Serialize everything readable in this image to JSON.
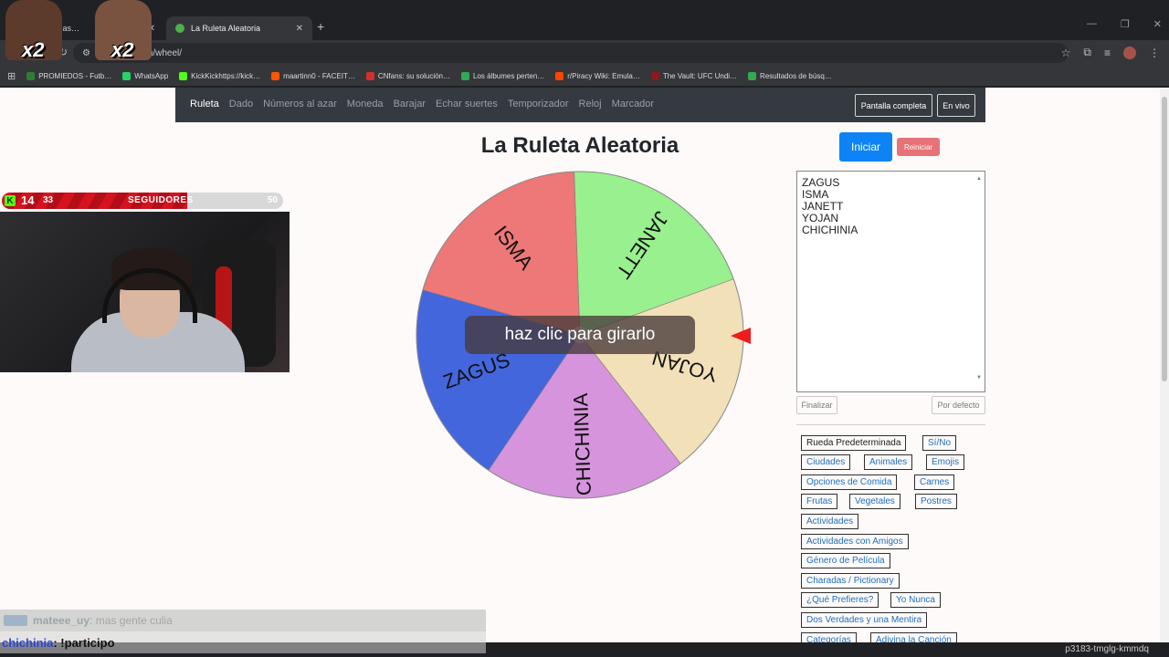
{
  "browser": {
    "tabs": [
      {
        "title": "m - Kick Das…"
      },
      {
        "title": "La Ruleta Aleatoria"
      }
    ],
    "url": ".com/random/wheel/",
    "bookmarks": [
      {
        "label": "PROMIEDOS - Futb…",
        "color": "#2e7d32"
      },
      {
        "label": "WhatsApp",
        "color": "#25d366"
      },
      {
        "label": "KickKickhttps://kick…",
        "color": "#53fc18"
      },
      {
        "label": "maartinn0 - FACEIT…",
        "color": "#ff5500"
      },
      {
        "label": "CNfans: su solución…",
        "color": "#d32f2f"
      },
      {
        "label": "Los álbumes perten…",
        "color": "#34a853"
      },
      {
        "label": "r/Piracy Wiki: Emula…",
        "color": "#ff4500"
      },
      {
        "label": "The Vault: UFC Undi…",
        "color": "#8b1a1a"
      },
      {
        "label": "Resultados de búsq…",
        "color": "#34a853"
      }
    ],
    "status_id": "p3183-tmglg-kmmdq"
  },
  "site": {
    "nav": [
      "Ruleta",
      "Dado",
      "Números al azar",
      "Moneda",
      "Barajar",
      "Echar suertes",
      "Temporizador",
      "Reloj",
      "Marcador"
    ],
    "fullscreen_label": "Pantalla completa",
    "live_label": "En vivo",
    "title": "La Ruleta Aleatoria",
    "start_label": "Iniciar",
    "reset_label": "Reiniciar",
    "names": [
      "ZAGUS",
      "ISMA",
      "JANETT",
      "YOJAN",
      "CHICHINIA"
    ],
    "finish_label": "Finalizar",
    "default_label": "Por defecto",
    "spin_hint": "haz clic para girarlo",
    "presets": [
      "Rueda Predeterminada",
      "Sí/No",
      "Ciudades",
      "Animales",
      "Emojis",
      "Opciones de Comida",
      "Carnes",
      "Frutas",
      "Vegetales",
      "Postres",
      "Actividades",
      "Actividades con Amigos",
      "Género de Película",
      "Charadas / Pictionary",
      "¿Qué Prefieres?",
      "Yo Nunca",
      "Dos Verdades y una Mentira",
      "Categorías",
      "Adivina la Canción"
    ]
  },
  "wheel": {
    "segments": [
      {
        "label": "ZAGUS",
        "color": "#4466dd"
      },
      {
        "label": "ISMA",
        "color": "#ee7777"
      },
      {
        "label": "JANETT",
        "color": "#99f08e"
      },
      {
        "label": "YOJAN",
        "color": "#f1e0b8"
      },
      {
        "label": "CHICHINIA",
        "color": "#d694dc"
      }
    ]
  },
  "overlay": {
    "follow_current": "14",
    "follow_prev": "33",
    "follow_label": "SEGUIDORES",
    "follow_goal": "50",
    "meme_text": "x2",
    "chat": [
      {
        "user": "mateee_uy",
        "message": ": mas gente culia"
      },
      {
        "user": "chichinia",
        "message": ": !participo"
      }
    ]
  }
}
